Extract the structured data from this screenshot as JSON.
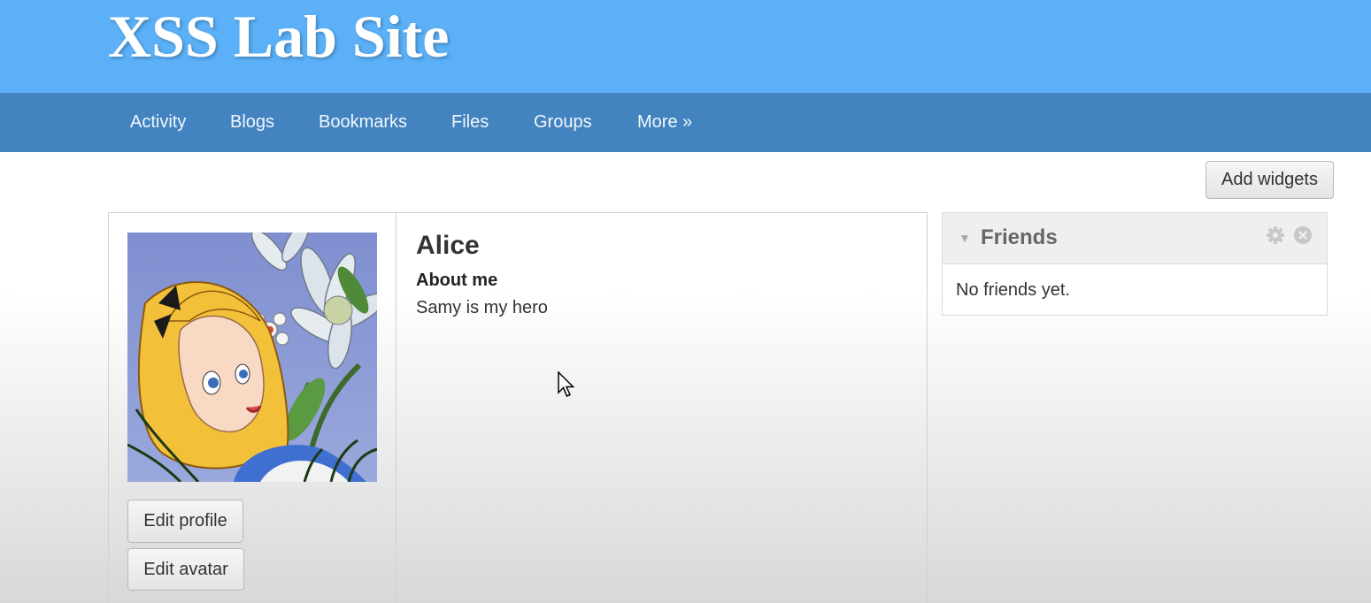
{
  "site": {
    "title": "XSS Lab Site"
  },
  "nav": {
    "items": [
      {
        "label": "Activity"
      },
      {
        "label": "Blogs"
      },
      {
        "label": "Bookmarks"
      },
      {
        "label": "Files"
      },
      {
        "label": "Groups"
      },
      {
        "label": "More »"
      }
    ]
  },
  "toolbar": {
    "add_widgets_label": "Add widgets"
  },
  "profile": {
    "name": "Alice",
    "about_label": "About me",
    "about_text": "Samy is my hero",
    "edit_profile_label": "Edit profile",
    "edit_avatar_label": "Edit avatar",
    "avatar_icon": "alice-avatar-image"
  },
  "friends_widget": {
    "title": "Friends",
    "empty_text": "No friends yet.",
    "icons": [
      "collapse-arrow-icon",
      "gear-icon",
      "close-icon"
    ]
  },
  "colors": {
    "header_bg": "#5bb0f7",
    "nav_bg": "#4283c0"
  }
}
